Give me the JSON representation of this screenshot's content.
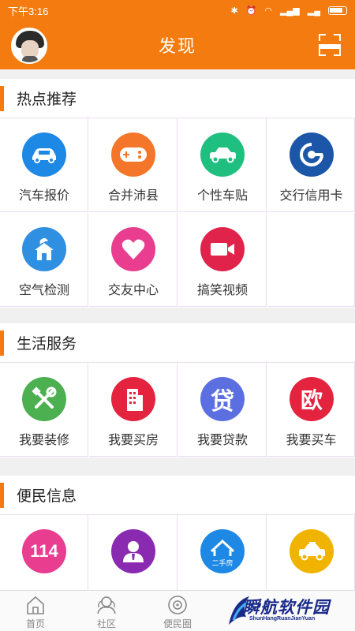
{
  "status": {
    "time": "下午3:16"
  },
  "header": {
    "title": "发现"
  },
  "sections": [
    {
      "title": "热点推荐",
      "items": [
        {
          "label": "汽车报价",
          "color": "#1e88e5",
          "icon": "car-icon"
        },
        {
          "label": "合并沛县",
          "color": "#f4762a",
          "icon": "gamepad-icon"
        },
        {
          "label": "个性车贴",
          "color": "#1fbf80",
          "icon": "car-sticker-icon"
        },
        {
          "label": "交行信用卡",
          "color": "#1b56a8",
          "icon": "bank-card-icon"
        },
        {
          "label": "空气检测",
          "color": "#2f8fe0",
          "icon": "house-tree-icon"
        },
        {
          "label": "交友中心",
          "color": "#e93d8f",
          "icon": "heart-icon"
        },
        {
          "label": "搞笑视频",
          "color": "#e0234a",
          "icon": "video-camera-icon"
        }
      ]
    },
    {
      "title": "生活服务",
      "items": [
        {
          "label": "我要装修",
          "color": "#4caf50",
          "icon": "tools-icon"
        },
        {
          "label": "我要买房",
          "color": "#e4233f",
          "icon": "building-icon"
        },
        {
          "label": "我要贷款",
          "color": "#5b6fe0",
          "icon": "loan-icon",
          "glyph": "贷"
        },
        {
          "label": "我要买车",
          "color": "#e4233f",
          "icon": "buy-car-icon",
          "glyph": "欧"
        }
      ]
    },
    {
      "title": "便民信息",
      "items": [
        {
          "label": "",
          "color": "#e93d8f",
          "icon": "phone-114-icon",
          "glyph": "114"
        },
        {
          "label": "",
          "color": "#8a2ab0",
          "icon": "person-icon"
        },
        {
          "label": "",
          "color": "#1e88e5",
          "icon": "second-hand-house-icon",
          "glyph": "二手房"
        },
        {
          "label": "",
          "color": "#f0b400",
          "icon": "taxi-icon"
        }
      ]
    }
  ],
  "tabs": [
    {
      "label": "首页",
      "icon": "home-icon"
    },
    {
      "label": "社区",
      "icon": "community-icon"
    },
    {
      "label": "便民圈",
      "icon": "circle-icon"
    }
  ],
  "watermark": {
    "title": "瞬航软件园",
    "subtitle": "ShunHangRuanJianYuan"
  }
}
